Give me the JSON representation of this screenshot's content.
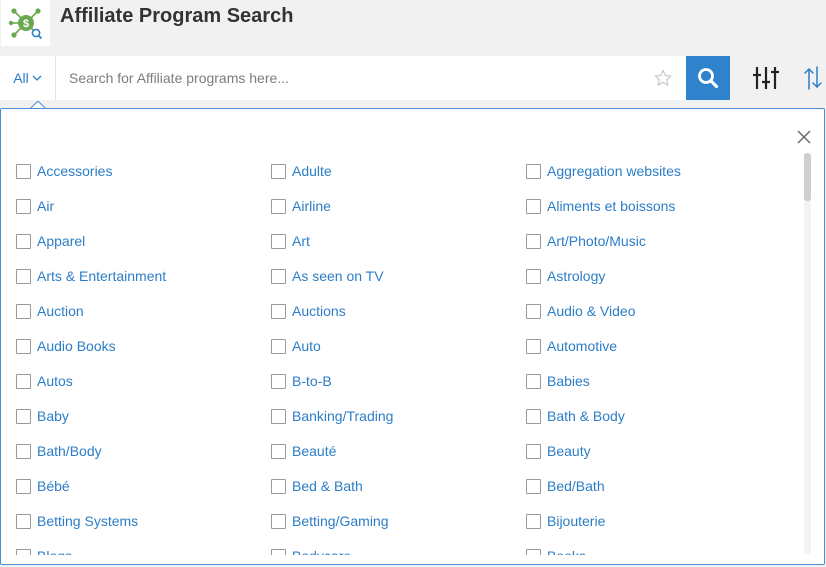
{
  "app": {
    "title": "Affiliate Program Search",
    "logo_icon": "dollar-network-icon",
    "accent": "#2f82cc",
    "link_color": "#2c7dc7"
  },
  "search": {
    "scope_label": "All",
    "placeholder": "Search for Affiliate programs here...",
    "value": ""
  },
  "toolbar": {
    "favorite_icon": "star-icon",
    "search_icon": "search-icon",
    "filter_icon": "sliders-icon",
    "sort_icon": "sort-arrows-icon"
  },
  "categories": [
    [
      "Accessories",
      "Adulte",
      "Aggregation websites"
    ],
    [
      "Air",
      "Airline",
      "Aliments et boissons"
    ],
    [
      "Apparel",
      "Art",
      "Art/Photo/Music"
    ],
    [
      "Arts & Entertainment",
      "As seen on TV",
      "Astrology"
    ],
    [
      "Auction",
      "Auctions",
      "Audio & Video"
    ],
    [
      "Audio Books",
      "Auto",
      "Automotive"
    ],
    [
      "Autos",
      "B-to-B",
      "Babies"
    ],
    [
      "Baby",
      "Banking/Trading",
      "Bath & Body"
    ],
    [
      "Bath/Body",
      "Beauté",
      "Beauty"
    ],
    [
      "Bébé",
      "Bed & Bath",
      "Bed/Bath"
    ],
    [
      "Betting Systems",
      "Betting/Gaming",
      "Bijouterie"
    ],
    [
      "Blogs",
      "Bodycare",
      "Books"
    ]
  ]
}
